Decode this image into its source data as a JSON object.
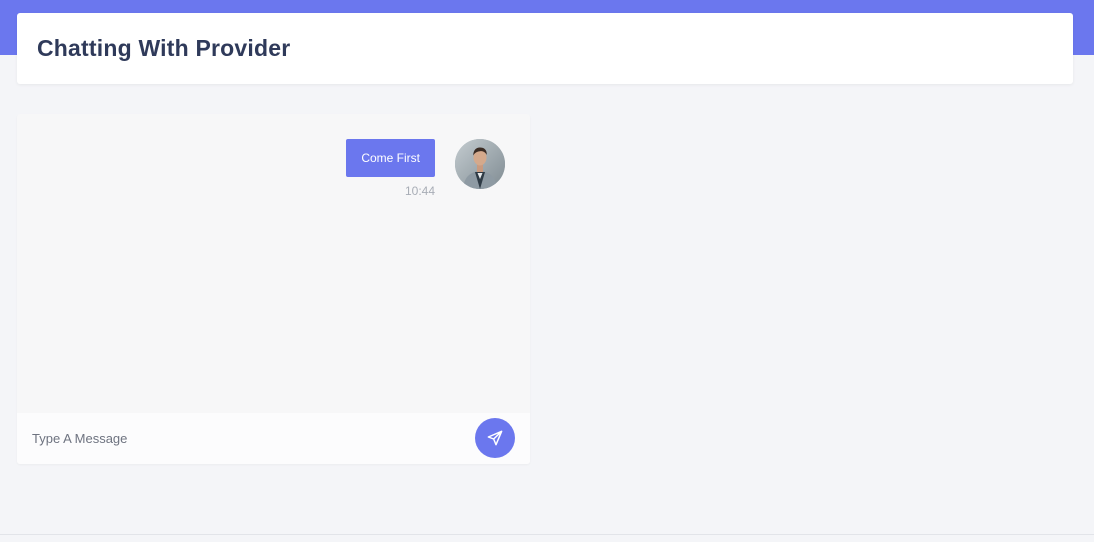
{
  "header": {
    "title": "Chatting With Provider"
  },
  "chat": {
    "messages": [
      {
        "text": "Come First",
        "time": "10:44",
        "sender": "self"
      }
    ],
    "composer": {
      "placeholder": "Type A Message",
      "value": "",
      "send_icon": "send-icon"
    }
  },
  "colors": {
    "brand": "#6b77ee",
    "title_text": "#2f3a5a",
    "page_bg": "#f4f5f8",
    "chat_bg": "#f7f7f8",
    "time_text": "#a8adb6"
  }
}
